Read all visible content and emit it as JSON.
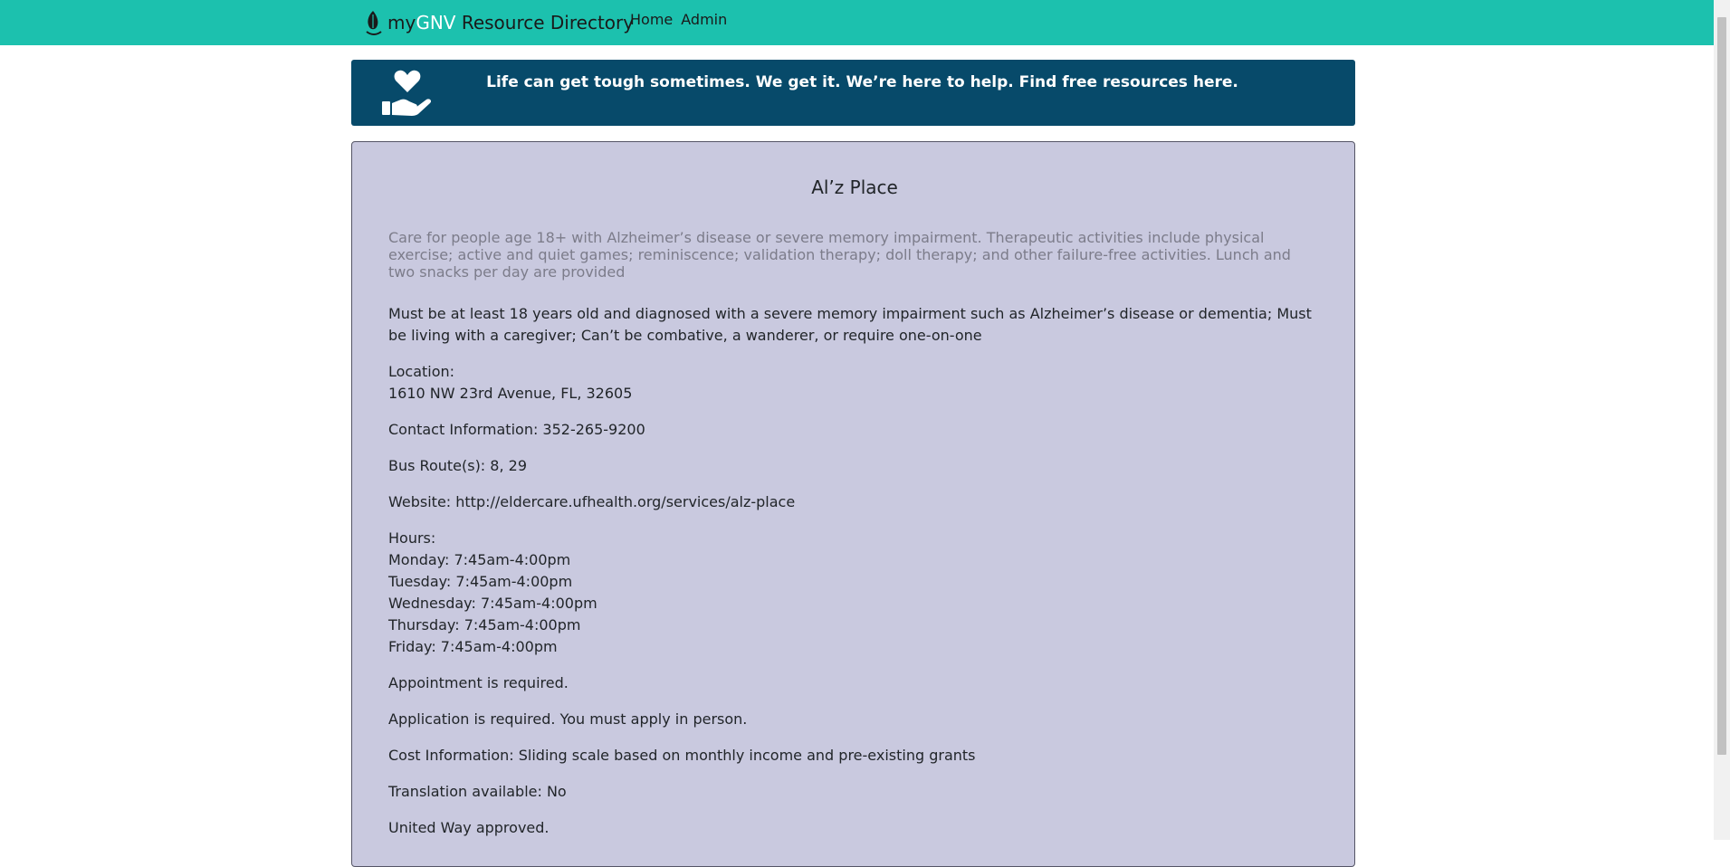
{
  "header": {
    "brand_prefix": "my",
    "brand_highlight": "GNV",
    "brand_suffix": " Resource Directory",
    "nav": [
      "Home",
      "Admin"
    ]
  },
  "banner": {
    "icon": "heart-hand-icon",
    "text": "Life can get tough sometimes. We get it. We’re here to help. Find free resources here."
  },
  "resource": {
    "title": "Al’z Place",
    "description": "Care for people age 18+ with Alzheimer’s disease or severe memory impairment. Therapeutic activities include physical exercise; active and quiet games; reminiscence; validation therapy; doll therapy; and other failure-free activities. Lunch and two snacks per day are provided",
    "eligibility": "Must be at least 18 years old and diagnosed with a severe memory impairment such as Alzheimer’s disease or dementia; Must be living with a caregiver; Can’t be combative, a wanderer, or require one-on-one",
    "location_label": "Location:",
    "location": "1610 NW 23rd Avenue, FL, 32605",
    "contact": "Contact Information: 352-265-9200",
    "bus_routes": "Bus Route(s): 8, 29",
    "website": "Website: http://eldercare.ufhealth.org/services/alz-place",
    "hours_label": "Hours:",
    "hours": [
      "Monday: 7:45am-4:00pm",
      "Tuesday: 7:45am-4:00pm",
      "Wednesday: 7:45am-4:00pm",
      "Thursday: 7:45am-4:00pm",
      "Friday: 7:45am-4:00pm"
    ],
    "appointment": "Appointment is required.",
    "application": "Application is required. You must apply in person.",
    "cost": "Cost Information: Sliding scale based on monthly income and pre-existing grants",
    "translation": "Translation available: No",
    "united_way": "United Way approved."
  },
  "colors": {
    "navbar": "#1cc1ae",
    "banner": "#074a6a",
    "card": "#c9c9df",
    "brand_highlight": "#ffffff"
  }
}
